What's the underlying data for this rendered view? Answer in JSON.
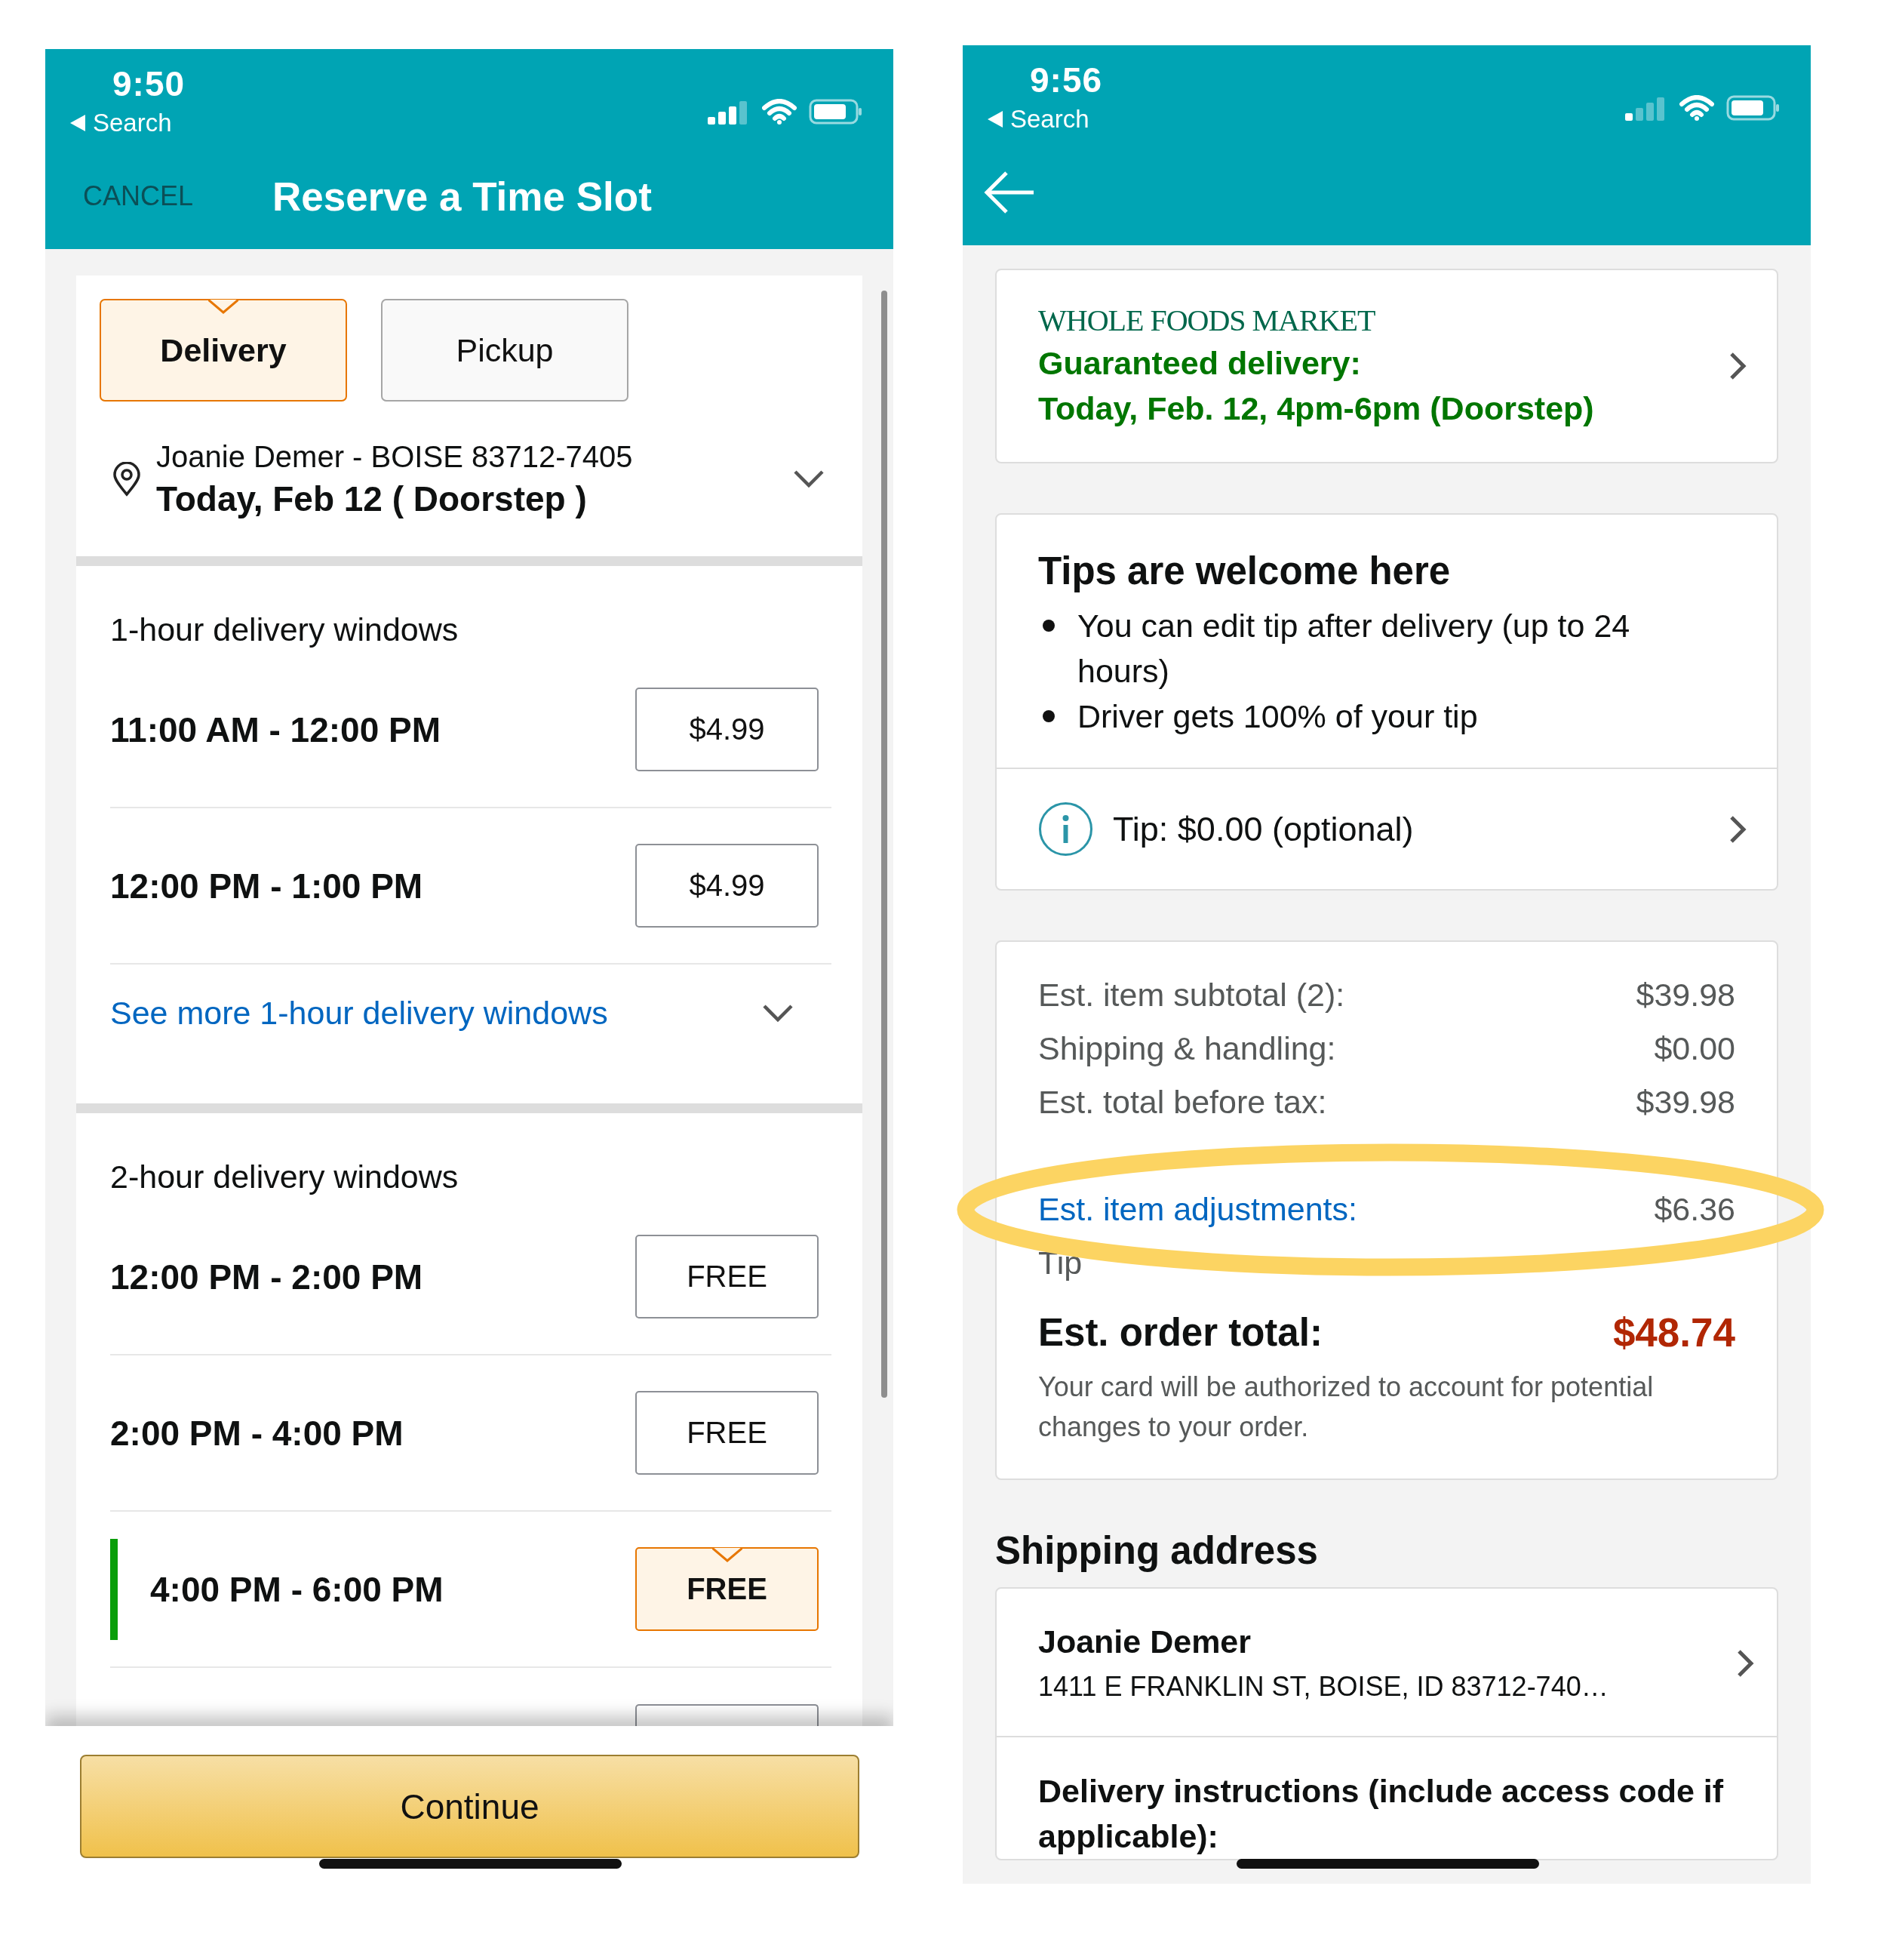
{
  "time_slot_screen": {
    "status_bar": {
      "time": "9:50",
      "back_label": "Search"
    },
    "header": {
      "cancel": "CANCEL",
      "title": "Reserve a Time Slot"
    },
    "tabs": [
      {
        "label": "Delivery",
        "selected": true
      },
      {
        "label": "Pickup",
        "selected": false
      }
    ],
    "address": {
      "line": "Joanie Demer - BOISE 83712-7405",
      "date": "Today, Feb 12 ( Doorstep )"
    },
    "sections": [
      {
        "heading": "1-hour delivery windows",
        "slots": [
          {
            "time": "11:00 AM - 12:00 PM",
            "price": "$4.99",
            "selected": false
          },
          {
            "time": "12:00 PM - 1:00 PM",
            "price": "$4.99",
            "selected": false
          }
        ],
        "see_more": "See more 1-hour delivery windows"
      },
      {
        "heading": "2-hour delivery windows",
        "slots": [
          {
            "time": "12:00 PM - 2:00 PM",
            "price": "FREE",
            "selected": false
          },
          {
            "time": "2:00 PM - 4:00 PM",
            "price": "FREE",
            "selected": false
          },
          {
            "time": "4:00 PM - 6:00 PM",
            "price": "FREE",
            "selected": true
          }
        ],
        "clipped_slot": true
      }
    ],
    "continue_button": "Continue"
  },
  "checkout_screen": {
    "status_bar": {
      "time": "9:56",
      "back_label": "Search"
    },
    "delivery_card": {
      "store": "WHOLE FOODS MARKET",
      "line1": "Guaranteed delivery:",
      "line2": "Today, Feb. 12, 4pm-6pm (Doorstep)"
    },
    "tips_card": {
      "title": "Tips are welcome here",
      "bullets": [
        "You can edit tip after delivery (up to 24 hours)",
        "Driver gets 100% of your tip"
      ],
      "tip": "Tip: $0.00 (optional)"
    },
    "summary": {
      "rows": [
        {
          "label": "Est. item subtotal (2):",
          "value": "$39.98",
          "kind": "plain"
        },
        {
          "label": "Shipping & handling:",
          "value": "$0.00",
          "kind": "plain"
        },
        {
          "label": "Est. total before tax:",
          "value": "$39.98",
          "kind": "plain"
        },
        {
          "kind": "covered"
        },
        {
          "label": "Est. item adjustments:",
          "value": "$6.36",
          "kind": "link"
        },
        {
          "label": "Tip",
          "kind": "plain"
        }
      ],
      "total_label": "Est. order total:",
      "total_value": "$48.74",
      "note": "Your card will be authorized to account for potential changes to your order."
    },
    "shipping": {
      "heading": "Shipping address",
      "name": "Joanie Demer",
      "address": "1411 E FRANKLIN ST, BOISE, ID 83712-740…",
      "instructions": "Delivery instructions (include access code if applicable):"
    }
  }
}
